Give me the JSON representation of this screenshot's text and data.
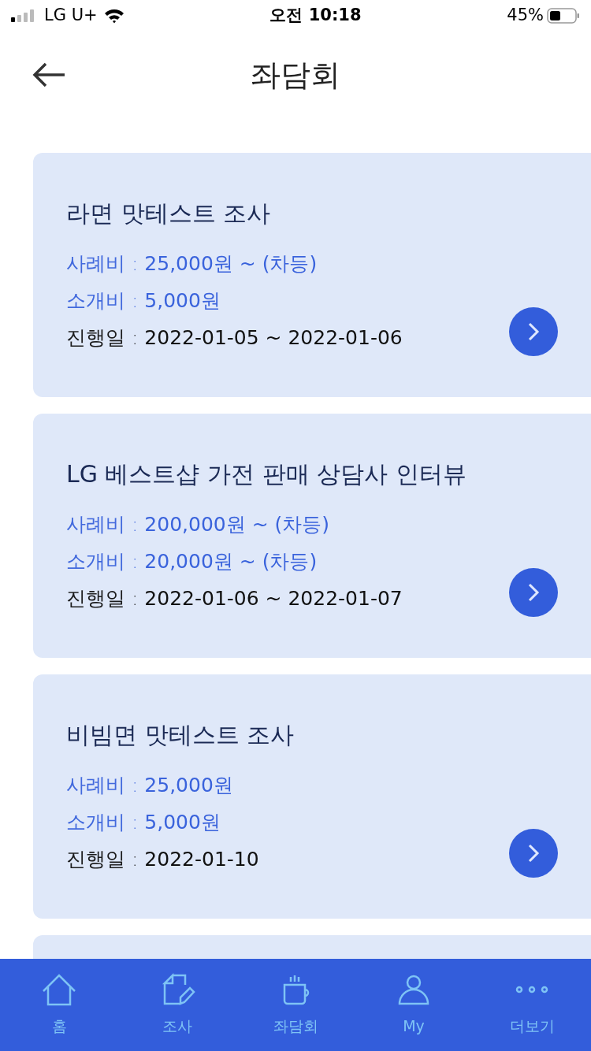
{
  "status_bar": {
    "carrier": "LG U+",
    "time": "오전 10:18",
    "battery": "45%"
  },
  "header": {
    "title": "좌담회"
  },
  "cards": [
    {
      "title": "라면 맛테스트 조사",
      "lines": [
        {
          "kind": "fee",
          "label": "사례비 :",
          "value": "25,000원 ~ (차등)"
        },
        {
          "kind": "fee",
          "label": "소개비 :",
          "value": "5,000원"
        },
        {
          "kind": "date",
          "label": "진행일 :",
          "value": "2022-01-05 ~ 2022-01-06"
        }
      ]
    },
    {
      "title": "LG 베스트샵 가전 판매 상담사 인터뷰",
      "lines": [
        {
          "kind": "fee",
          "label": "사례비 :",
          "value": "200,000원 ~ (차등)"
        },
        {
          "kind": "fee",
          "label": "소개비 :",
          "value": "20,000원 ~ (차등)"
        },
        {
          "kind": "date",
          "label": "진행일 :",
          "value": "2022-01-06 ~ 2022-01-07"
        }
      ]
    },
    {
      "title": "비빔면 맛테스트 조사",
      "lines": [
        {
          "kind": "fee",
          "label": "사례비 :",
          "value": "25,000원"
        },
        {
          "kind": "fee",
          "label": "소개비 :",
          "value": "5,000원"
        },
        {
          "kind": "date",
          "label": "진행일 :",
          "value": "2022-01-10"
        }
      ]
    }
  ],
  "tab_bar": [
    {
      "kind": "home",
      "label": "홈"
    },
    {
      "kind": "survey",
      "label": "조사"
    },
    {
      "kind": "meeting",
      "label": "좌담회"
    },
    {
      "kind": "my",
      "label": "My"
    },
    {
      "kind": "more",
      "label": "더보기"
    }
  ]
}
